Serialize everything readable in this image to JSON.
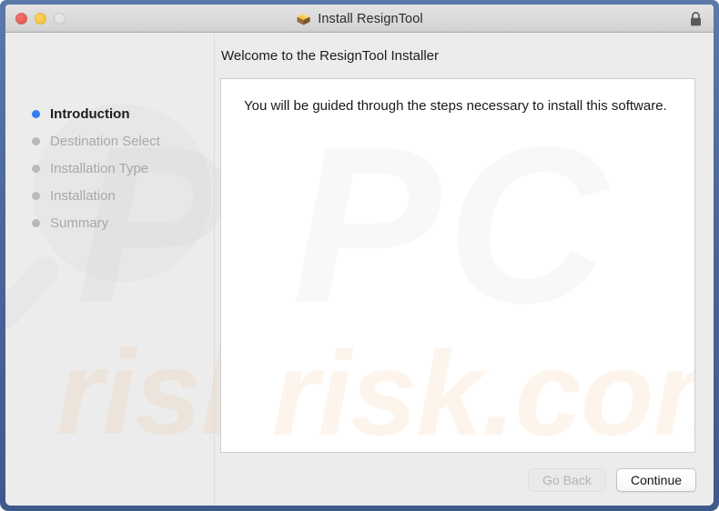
{
  "window": {
    "title": "Install ResignTool",
    "title_icon": "package-box-icon",
    "lock_icon": "lock-closed-icon",
    "traffic_lights": [
      {
        "name": "close",
        "color": "#e45c55"
      },
      {
        "name": "minimize",
        "color": "#f6c241"
      },
      {
        "name": "zoom",
        "color": "#e0e0e0"
      }
    ]
  },
  "sidebar": {
    "steps": [
      {
        "label": "Introduction",
        "state": "active"
      },
      {
        "label": "Destination Select",
        "state": "pending"
      },
      {
        "label": "Installation Type",
        "state": "pending"
      },
      {
        "label": "Installation",
        "state": "pending"
      },
      {
        "label": "Summary",
        "state": "pending"
      }
    ],
    "active_dot_color": "#2f7cf6",
    "pending_dot_color": "#b9b9b9"
  },
  "main": {
    "heading": "Welcome to the ResignTool Installer",
    "body_text": "You will be guided through the steps necessary to install this software."
  },
  "footer": {
    "go_back_label": "Go Back",
    "go_back_enabled": false,
    "continue_label": "Continue",
    "continue_enabled": true
  },
  "watermark": {
    "primary": "PC",
    "secondary": "risk.com"
  }
}
